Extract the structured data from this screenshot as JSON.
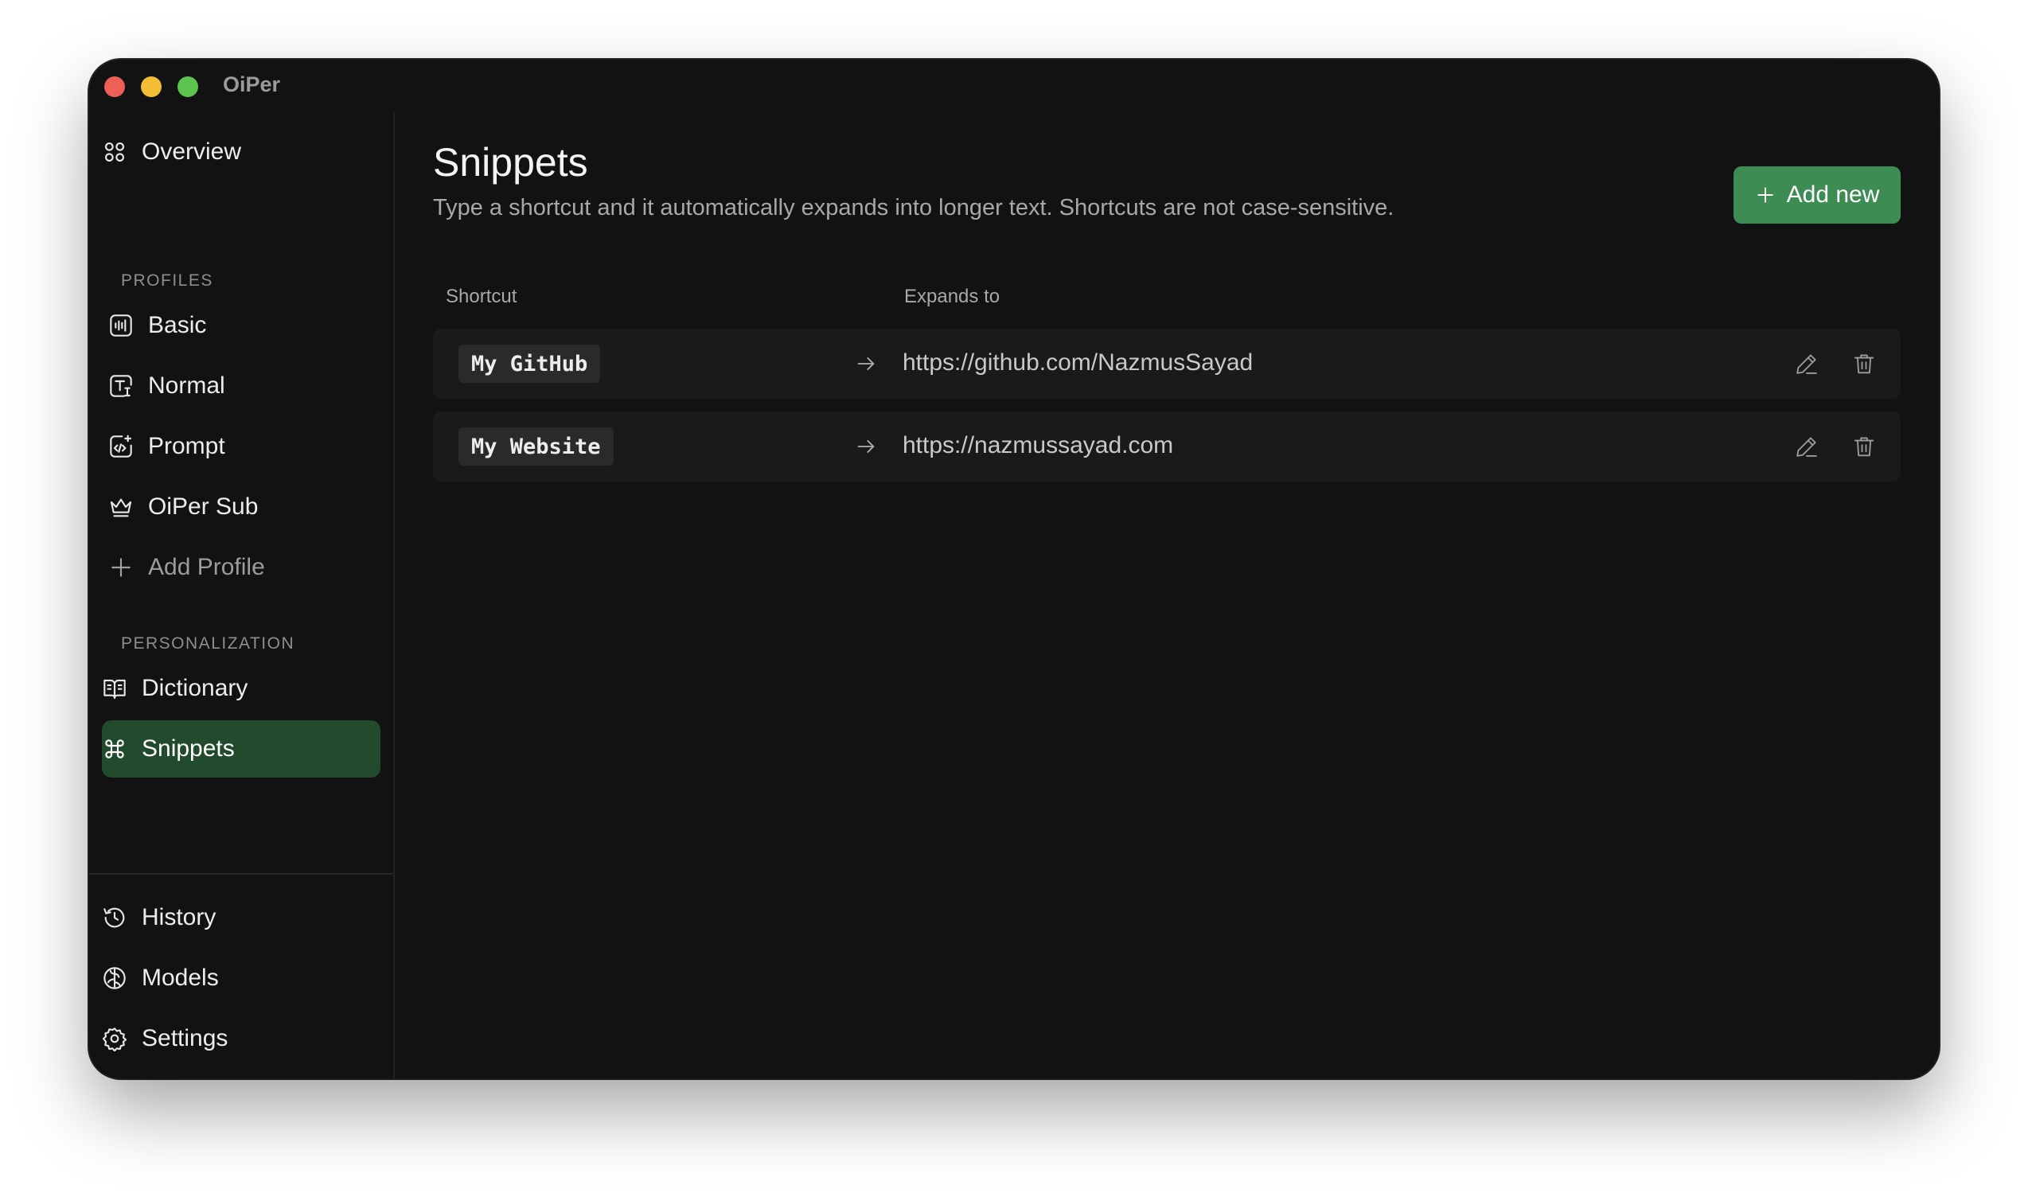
{
  "window": {
    "title": "OiPer"
  },
  "sidebar": {
    "overview": {
      "label": "Overview",
      "icon": "grid-icon"
    },
    "profiles_label": "PROFILES",
    "profiles": [
      {
        "label": "Basic",
        "icon": "waveform-icon"
      },
      {
        "label": "Normal",
        "icon": "text-cursor-icon"
      },
      {
        "label": "Prompt",
        "icon": "code-sparkle-icon"
      },
      {
        "label": "OiPer Sub",
        "icon": "crown-icon"
      }
    ],
    "add_profile": {
      "label": "Add Profile",
      "icon": "plus-icon"
    },
    "personalization_label": "PERSONALIZATION",
    "personalization": [
      {
        "label": "Dictionary",
        "icon": "book-icon"
      },
      {
        "label": "Snippets",
        "icon": "command-icon",
        "active": true
      }
    ],
    "bottom": [
      {
        "label": "History",
        "icon": "history-icon"
      },
      {
        "label": "Models",
        "icon": "brain-icon"
      },
      {
        "label": "Settings",
        "icon": "gear-icon"
      }
    ]
  },
  "main": {
    "title": "Snippets",
    "subtitle": "Type a shortcut and it automatically expands into longer text. Shortcuts are not case-sensitive.",
    "add_button": "Add new",
    "columns": {
      "shortcut": "Shortcut",
      "expands_to": "Expands to"
    },
    "snippets": [
      {
        "shortcut": "My GitHub",
        "expansion": "https://github.com/NazmusSayad"
      },
      {
        "shortcut": "My Website",
        "expansion": "https://nazmussayad.com"
      }
    ]
  },
  "colors": {
    "window_bg": "#121212",
    "active_nav_bg": "#224a2d",
    "accent_button": "#3d8c54",
    "row_bg": "#1a1a1a",
    "chip_bg": "#2a2a2a"
  }
}
